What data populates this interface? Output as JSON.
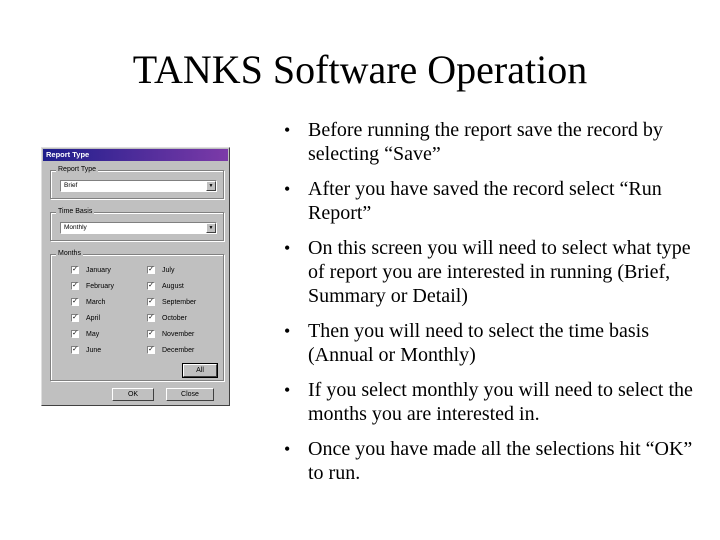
{
  "slide": {
    "title": "TANKS Software Operation",
    "bullets": [
      "Before running the report save the record by selecting “Save”",
      "After you have saved the record select “Run Report”",
      "On this screen you will need to select what type of report you are interested in running (Brief, Summary or Detail)",
      "Then you will need to select the time basis (Annual or Monthly)",
      "If you select monthly you will need to select the months you are interested in.",
      "Once you have made all the selections hit “OK” to run."
    ],
    "bullet_glyph": "•"
  },
  "dialog": {
    "title": "Report Type",
    "title_colors": [
      "#1e1e8c",
      "#7c3aa8"
    ],
    "report_type": {
      "label": "Report Type",
      "value": "Brief"
    },
    "time_basis": {
      "label": "Time Basis",
      "value": "Monthly"
    },
    "months": {
      "label": "Months",
      "left": [
        {
          "name": "January",
          "checked": true
        },
        {
          "name": "February",
          "checked": true
        },
        {
          "name": "March",
          "checked": true
        },
        {
          "name": "April",
          "checked": true
        },
        {
          "name": "May",
          "checked": true
        },
        {
          "name": "June",
          "checked": true
        }
      ],
      "right": [
        {
          "name": "July",
          "checked": true
        },
        {
          "name": "August",
          "checked": true
        },
        {
          "name": "September",
          "checked": true
        },
        {
          "name": "October",
          "checked": true
        },
        {
          "name": "November",
          "checked": true
        },
        {
          "name": "December",
          "checked": true
        }
      ],
      "all_button": "All"
    },
    "ok_button": "OK",
    "close_button": "Close",
    "check_glyph": "✓",
    "arrow_glyph": "▼"
  }
}
